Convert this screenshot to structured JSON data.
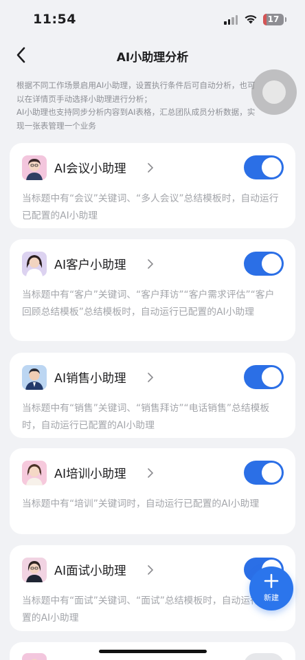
{
  "status": {
    "time": "11:54",
    "battery": "17",
    "battery_fraction": 0.17
  },
  "nav": {
    "title": "AI小助理分析"
  },
  "intro": {
    "lines": [
      "根据不同工作场景启用AI小助理，设置执行条件后可自动分析，也可",
      "以在详情页手动选择小助理进行分析；",
      "AI小助理也支持同步分析内容到AI表格，汇总团队成员分析数据，实",
      "现一张表管理一个业务"
    ]
  },
  "assistants": [
    {
      "title": "AI会议小助理",
      "enabled": true,
      "desc": "当标题中有“会议”关键词、“多人会议”总结模板时，自动运行已配置的AI小助理"
    },
    {
      "title": "AI客户小助理",
      "enabled": true,
      "desc": "当标题中有“客户”关键词、“客户拜访”“客户需求评估”“客户回顾总结模板”总结模板时，自动运行已配置的AI小助理"
    },
    {
      "title": "AI销售小助理",
      "enabled": true,
      "desc": "当标题中有“销售”关键词、“销售拜访”“电话销售”总结模板时，自动运行已配置的AI小助理"
    },
    {
      "title": "AI培训小助理",
      "enabled": true,
      "desc": "当标题中有“培训”关键词时，自动运行已配置的AI小助理"
    },
    {
      "title": "AI面试小助理",
      "enabled": true,
      "desc": "当标题中有“面试”关键词、“面试”总结模板时，自动运行已配置的AI小助理"
    }
  ],
  "fab": {
    "label": "新建",
    "icon": "plus-icon"
  },
  "colors": {
    "accent": "#2b6fe6",
    "background": "#f1f2f5",
    "card": "#ffffff"
  }
}
